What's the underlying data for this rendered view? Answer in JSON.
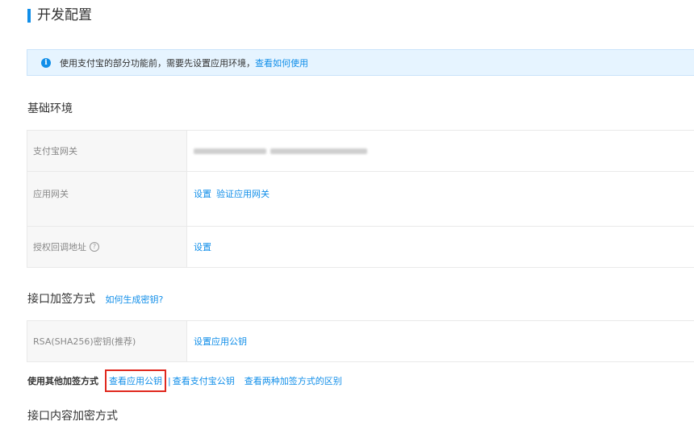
{
  "page": {
    "title": "开发配置"
  },
  "banner": {
    "text": "使用支付宝的部分功能前，需要先设置应用环境，",
    "link": "查看如何使用",
    "icon": "info-icon",
    "accent": "#108ee9",
    "background": "#e6f4ff"
  },
  "basic_env": {
    "title": "基础环境",
    "rows": [
      {
        "label": "支付宝网关",
        "value": ""
      },
      {
        "label": "应用网关",
        "link1": "设置",
        "link2": "验证应用网关"
      },
      {
        "label": "授权回调地址",
        "help": "?",
        "link1": "设置"
      }
    ]
  },
  "signing": {
    "title": "接口加签方式",
    "help_link": "如何生成密钥?",
    "rows": [
      {
        "label": "RSA(SHA256)密钥(推荐)",
        "link1": "设置应用公钥"
      }
    ],
    "other": {
      "label": "使用其他加签方式",
      "link_app_key": "查看应用公钥",
      "separator": "|",
      "link_alipay_key": "查看支付宝公钥",
      "link_diff": "查看两种加签方式的区别",
      "highlight_color": "#e0281e"
    }
  },
  "encryption": {
    "title": "接口内容加密方式"
  }
}
